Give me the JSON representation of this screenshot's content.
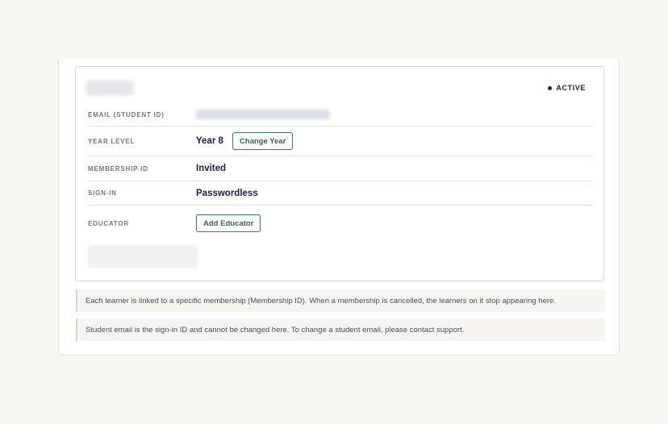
{
  "learner": {
    "status": "ACTIVE",
    "rows": {
      "email_label": "EMAIL (STUDENT ID)",
      "year_label": "YEAR LEVEL",
      "year_value": "Year 8",
      "change_year_button": "Change Year",
      "membership_label": "MEMBERSHIP ID",
      "membership_value": "Invited",
      "signin_label": "SIGN-IN",
      "signin_value": "Passwordless",
      "educator_label": "EDUCATOR",
      "add_educator_button": "Add Educator"
    }
  },
  "notes": {
    "membership_note": "Each learner is linked to a specific membership (Membership ID). When a membership is cancelled, the learners on it stop appearing here.",
    "email_note": "Student email is the sign-in ID and cannot be changed here. To change a student email, please contact support."
  },
  "colors": {
    "page_bg": "#f8f7f4",
    "text_primary": "#1f1d4a",
    "label_muted": "#73758f",
    "button_green": "#2f6b4b"
  }
}
